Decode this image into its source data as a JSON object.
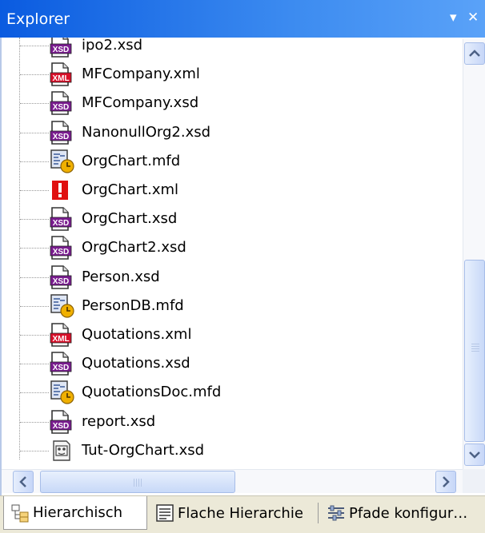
{
  "window": {
    "title": "Explorer",
    "menu_glyph": "▾",
    "close_glyph": "✕"
  },
  "icon_colors": {
    "xsd": "#7a1d8f",
    "xml": "#d8102a",
    "error": "#e01010",
    "mfd_clock": "#f0b000"
  },
  "tree": {
    "items": [
      {
        "label": "ipo2.xsd",
        "type": "xsd"
      },
      {
        "label": "MFCompany.xml",
        "type": "xml"
      },
      {
        "label": "MFCompany.xsd",
        "type": "xsd"
      },
      {
        "label": "NanonullOrg2.xsd",
        "type": "xsd"
      },
      {
        "label": "OrgChart.mfd",
        "type": "mfd"
      },
      {
        "label": "OrgChart.xml",
        "type": "error"
      },
      {
        "label": "OrgChart.xsd",
        "type": "xsd"
      },
      {
        "label": "OrgChart2.xsd",
        "type": "xsd"
      },
      {
        "label": "Person.xsd",
        "type": "xsd"
      },
      {
        "label": "PersonDB.mfd",
        "type": "mfd"
      },
      {
        "label": "Quotations.xml",
        "type": "xml"
      },
      {
        "label": "Quotations.xsd",
        "type": "xsd"
      },
      {
        "label": "QuotationsDoc.mfd",
        "type": "mfd"
      },
      {
        "label": "report.xsd",
        "type": "xsd"
      },
      {
        "label": "Tut-OrgChart.xsd",
        "type": "gray"
      }
    ]
  },
  "tabs": [
    {
      "label": "Hierarchisch",
      "icon": "hierarchy-icon",
      "active": true
    },
    {
      "label": "Flache Hierarchie",
      "icon": "flat-list-icon",
      "active": false
    },
    {
      "label": "Pfade konfigur…",
      "icon": "configure-paths-icon",
      "active": false
    }
  ]
}
